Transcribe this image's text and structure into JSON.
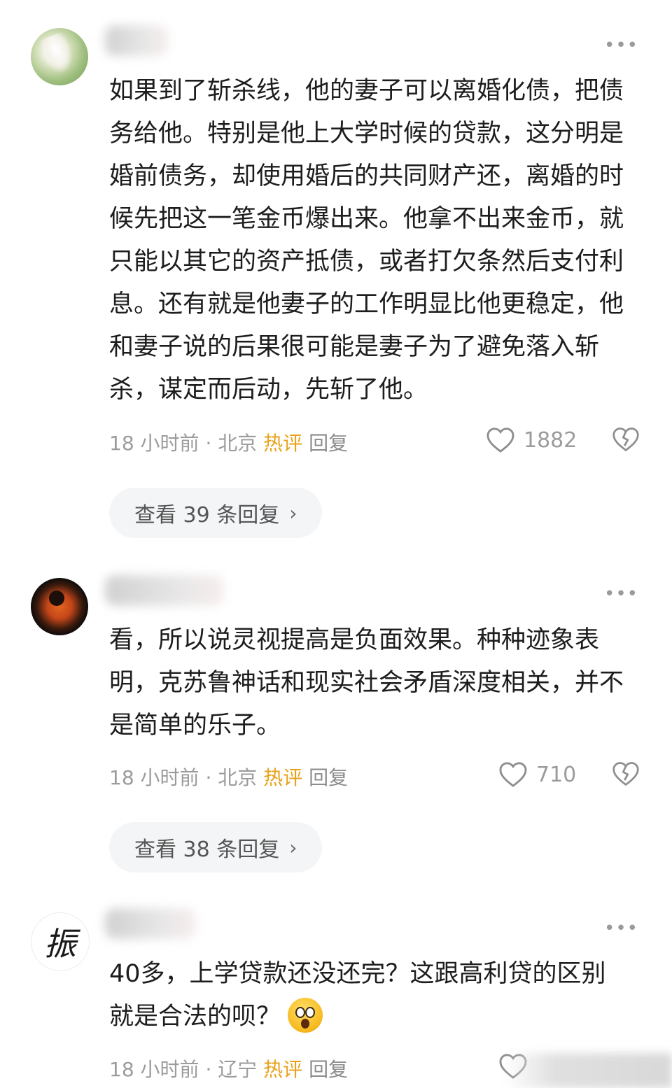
{
  "comments": [
    {
      "avatar": "flower-avatar",
      "text": "如果到了斩杀线，他的妻子可以离婚化债，把债务给他。特别是他上大学时候的贷款，这分明是婚前债务，却使用婚后的共同财产还，离婚的时候先把这一笔金币爆出来。他拿不出来金币，就只能以其它的资产抵债，或者打欠条然后支付利息。还有就是他妻子的工作明显比他更稳定，他和妻子说的后果很可能是妻子为了避免落入斩杀，谋定而后动，先斩了他。",
      "time": "18 小时前",
      "sep": "·",
      "location": "北京",
      "badge": "热评",
      "reply_label": "回复",
      "likes": "1882",
      "replies_label": "查看 39 条回复",
      "chevron": "›"
    },
    {
      "avatar": "eclipse-avatar",
      "text": "看，所以说灵视提高是负面效果。种种迹象表明，克苏鲁神话和现实社会矛盾深度相关，并不是简单的乐子。",
      "time": "18 小时前",
      "sep": "·",
      "location": "北京",
      "badge": "热评",
      "reply_label": "回复",
      "likes": "710",
      "replies_label": "查看 38 条回复",
      "chevron": "›"
    },
    {
      "avatar": "calligraphy-avatar",
      "avatar_char": "振",
      "text": "40多，上学贷款还没还完？这跟高利贷的区别就是合法的呗？",
      "time": "18 小时前",
      "sep": "·",
      "location": "辽宁",
      "badge": "热评",
      "reply_label": "回复"
    }
  ],
  "more_icon": "•••",
  "colors": {
    "badge": "#e8a21a",
    "meta": "#9b9b9b",
    "text": "#1d1d1d",
    "pill": "#f4f5f7"
  }
}
